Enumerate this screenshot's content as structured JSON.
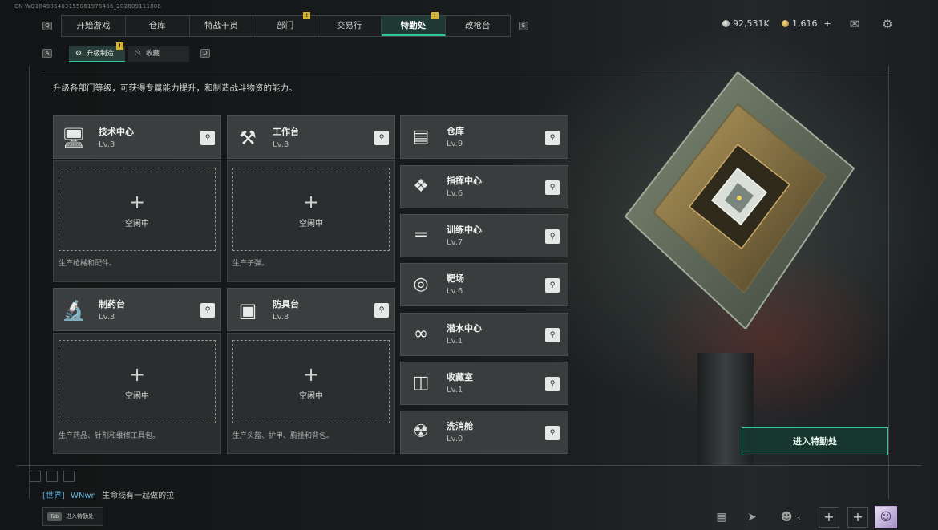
{
  "build_id": "CN-WQ184985403155061976406_202609111808",
  "nav": {
    "left_key": "Q",
    "right_key": "E",
    "tabs": [
      {
        "label": "开始游戏",
        "badge": ""
      },
      {
        "label": "仓库",
        "badge": ""
      },
      {
        "label": "特战干员",
        "badge": ""
      },
      {
        "label": "部门",
        "badge": "!"
      },
      {
        "label": "交易行",
        "badge": ""
      },
      {
        "label": "特勤处",
        "badge": "!"
      },
      {
        "label": "改枪台",
        "badge": ""
      }
    ],
    "active_index": 5
  },
  "currency": {
    "silver": "92,531K",
    "gold": "1,616",
    "gold_add": "+"
  },
  "icons": {
    "mail": "mail-icon",
    "settings": "gear-icon"
  },
  "subnav": {
    "left_key": "A",
    "right_key": "D",
    "tabs": [
      {
        "label": "升级制造",
        "badge": "!"
      },
      {
        "label": "收藏",
        "badge": ""
      }
    ]
  },
  "description": "升级各部门等级，可获得专属能力提升，和制造战斗物资的能力。",
  "workshops": [
    {
      "name": "技术中心",
      "level": "Lv.3",
      "icon": "computer-icon",
      "status": "空闲中",
      "footer": "生产枪械和配件。"
    },
    {
      "name": "工作台",
      "level": "Lv.3",
      "icon": "tools-icon",
      "status": "空闲中",
      "footer": "生产子弹。"
    },
    {
      "name": "制药台",
      "level": "Lv.3",
      "icon": "microscope-icon",
      "status": "空闲中",
      "footer": "生产药品、针剂和维修工具包。"
    },
    {
      "name": "防具台",
      "level": "Lv.3",
      "icon": "armor-icon",
      "status": "空闲中",
      "footer": "生产头盔、护甲、胸挂和背包。"
    }
  ],
  "facilities": [
    {
      "name": "仓库",
      "level": "Lv.9",
      "icon": "warehouse-icon"
    },
    {
      "name": "指挥中心",
      "level": "Lv.6",
      "icon": "command-icon"
    },
    {
      "name": "训练中心",
      "level": "Lv.7",
      "icon": "dumbbell-icon"
    },
    {
      "name": "靶场",
      "level": "Lv.6",
      "icon": "target-icon"
    },
    {
      "name": "潜水中心",
      "level": "Lv.1",
      "icon": "diving-mask-icon"
    },
    {
      "name": "收藏室",
      "level": "Lv.1",
      "icon": "collection-icon"
    },
    {
      "name": "洗消舱",
      "level": "Lv.0",
      "icon": "decontamination-icon"
    }
  ],
  "enter_button": "进入特勤处",
  "chat": {
    "channel": "[世界]",
    "user": "WNwn",
    "message": "生命线有一起做的拉"
  },
  "tab_hint": {
    "key": "Tab",
    "label": "进入特勤处"
  },
  "bottom": {
    "stats_icon": "bar-chart-icon",
    "gun_icon": "gun-icon",
    "friends_count": "3",
    "plus_label": "+"
  }
}
